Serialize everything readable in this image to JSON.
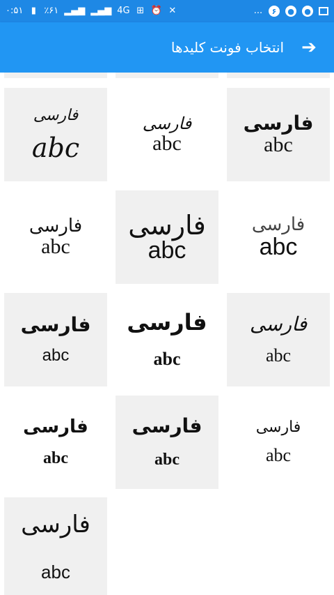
{
  "status_bar": {
    "time": "۰:۵۱",
    "battery": "٪۶۱",
    "network": "4G",
    "notification_count": "۶",
    "more": "..."
  },
  "app_bar": {
    "title": "انتخاب فونت کلیدها",
    "back_icon": "arrow-right-icon"
  },
  "fonts": [
    {
      "farsi": "فارسی",
      "latin": "abc"
    },
    {
      "farsi": "فارسی",
      "latin": "abc"
    },
    {
      "farsi": "فارسی",
      "latin": "abc"
    },
    {
      "farsi": "فارسی",
      "latin": "abc"
    },
    {
      "farsi": "فارسی",
      "latin": "abc"
    },
    {
      "farsi": "فارسی",
      "latin": "abc"
    },
    {
      "farsi": "فارسی",
      "latin": "abc"
    },
    {
      "farsi": "فارسی",
      "latin": "abc"
    },
    {
      "farsi": "فارسی",
      "latin": "abc"
    },
    {
      "farsi": "فارسی",
      "latin": "abc"
    },
    {
      "farsi": "فارسی",
      "latin": "abc"
    },
    {
      "farsi": "فارسی",
      "latin": "abc"
    },
    {
      "farsi": "فارسی",
      "latin": "abc"
    }
  ],
  "colors": {
    "primary": "#2196F3",
    "status_bar": "#1E88E5",
    "tile_gray": "#f0f0f0",
    "tile_white": "#ffffff"
  }
}
